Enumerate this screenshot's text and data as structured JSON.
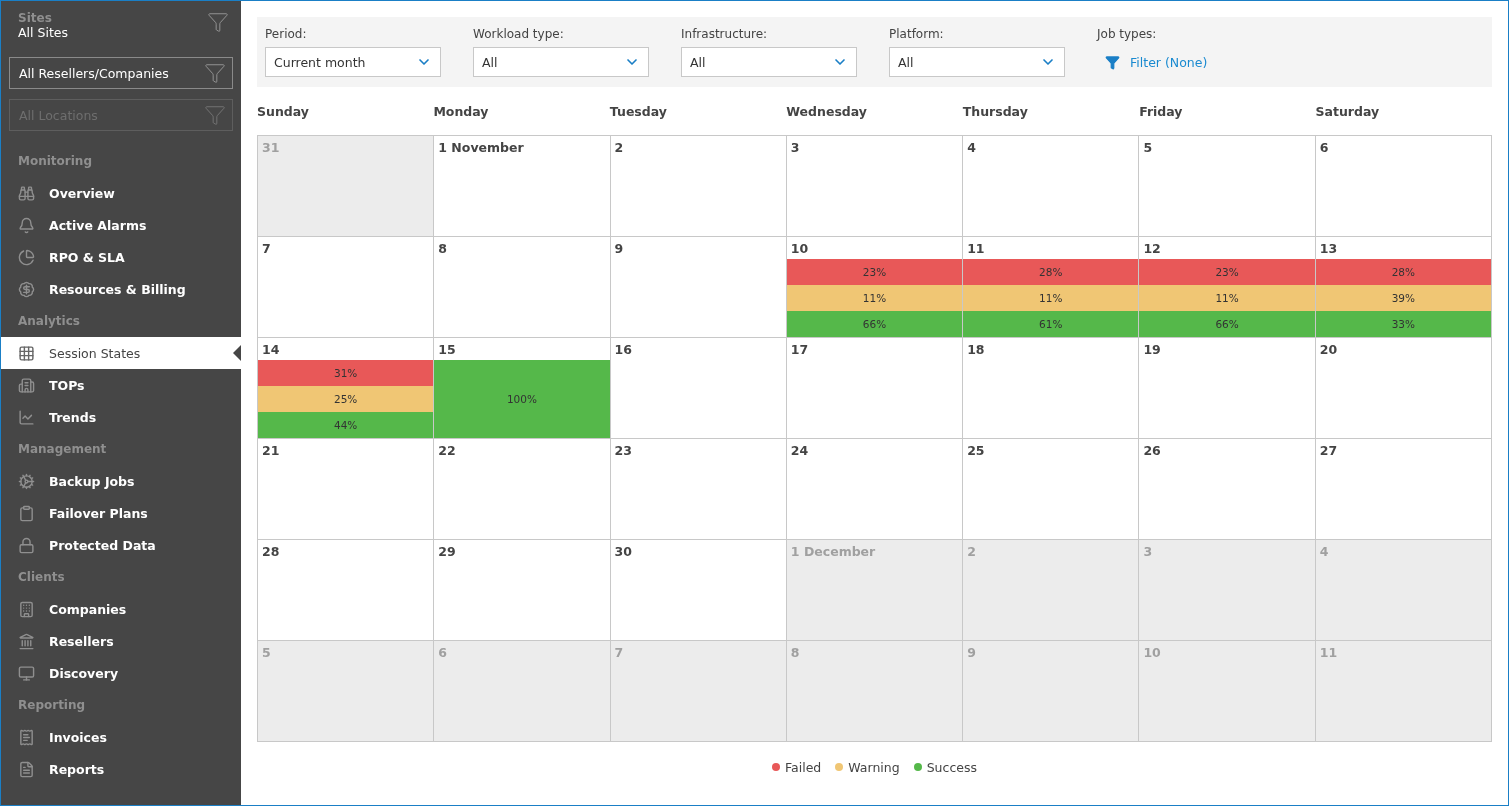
{
  "sidebar": {
    "site_filter": {
      "label": "Sites",
      "value": "All Sites"
    },
    "filters": [
      {
        "value": "All Resellers/Companies",
        "disabled": false
      },
      {
        "value": "All Locations",
        "disabled": true
      }
    ],
    "sections": [
      {
        "heading": "Monitoring",
        "items": [
          {
            "label": "Overview",
            "selected": false
          },
          {
            "label": "Active Alarms",
            "selected": false
          },
          {
            "label": "RPO & SLA",
            "selected": false
          },
          {
            "label": "Resources & Billing",
            "selected": false
          }
        ]
      },
      {
        "heading": "Analytics",
        "items": [
          {
            "label": "Session States",
            "selected": true
          },
          {
            "label": "TOPs",
            "selected": false
          },
          {
            "label": "Trends",
            "selected": false
          }
        ]
      },
      {
        "heading": "Management",
        "items": [
          {
            "label": "Backup Jobs",
            "selected": false
          },
          {
            "label": "Failover Plans",
            "selected": false
          },
          {
            "label": "Protected Data",
            "selected": false
          }
        ]
      },
      {
        "heading": "Clients",
        "items": [
          {
            "label": "Companies",
            "selected": false
          },
          {
            "label": "Resellers",
            "selected": false
          },
          {
            "label": "Discovery",
            "selected": false
          }
        ]
      },
      {
        "heading": "Reporting",
        "items": [
          {
            "label": "Invoices",
            "selected": false
          },
          {
            "label": "Reports",
            "selected": false
          }
        ]
      }
    ]
  },
  "filters": [
    {
      "label": "Period:",
      "value": "Current month"
    },
    {
      "label": "Workload type:",
      "value": "All"
    },
    {
      "label": "Infrastructure:",
      "value": "All"
    },
    {
      "label": "Platform:",
      "value": "All"
    }
  ],
  "job_types": {
    "label": "Job types:",
    "link": "Filter (None)"
  },
  "weekdays": [
    "Sunday",
    "Monday",
    "Tuesday",
    "Wednesday",
    "Thursday",
    "Friday",
    "Saturday"
  ],
  "days": [
    {
      "label": "31",
      "muted": true
    },
    {
      "label": "1 November",
      "muted": false
    },
    {
      "label": "2",
      "muted": false
    },
    {
      "label": "3",
      "muted": false
    },
    {
      "label": "4",
      "muted": false
    },
    {
      "label": "5",
      "muted": false
    },
    {
      "label": "6",
      "muted": false
    },
    {
      "label": "7",
      "muted": false
    },
    {
      "label": "8",
      "muted": false
    },
    {
      "label": "9",
      "muted": false
    },
    {
      "label": "10",
      "muted": false,
      "bars": [
        {
          "kind": "failed",
          "text": "23%"
        },
        {
          "kind": "warning",
          "text": "11%"
        },
        {
          "kind": "success",
          "text": "66%"
        }
      ]
    },
    {
      "label": "11",
      "muted": false,
      "bars": [
        {
          "kind": "failed",
          "text": "28%"
        },
        {
          "kind": "warning",
          "text": "11%"
        },
        {
          "kind": "success",
          "text": "61%"
        }
      ]
    },
    {
      "label": "12",
      "muted": false,
      "bars": [
        {
          "kind": "failed",
          "text": "23%"
        },
        {
          "kind": "warning",
          "text": "11%"
        },
        {
          "kind": "success",
          "text": "66%"
        }
      ]
    },
    {
      "label": "13",
      "muted": false,
      "bars": [
        {
          "kind": "failed",
          "text": "28%"
        },
        {
          "kind": "warning",
          "text": "39%"
        },
        {
          "kind": "success",
          "text": "33%"
        }
      ]
    },
    {
      "label": "14",
      "muted": false,
      "bars": [
        {
          "kind": "failed",
          "text": "31%"
        },
        {
          "kind": "warning",
          "text": "25%"
        },
        {
          "kind": "success",
          "text": "44%"
        }
      ]
    },
    {
      "label": "15",
      "muted": false,
      "bars": [
        {
          "kind": "success",
          "text": "100%"
        }
      ]
    },
    {
      "label": "16",
      "muted": false
    },
    {
      "label": "17",
      "muted": false
    },
    {
      "label": "18",
      "muted": false
    },
    {
      "label": "19",
      "muted": false
    },
    {
      "label": "20",
      "muted": false
    },
    {
      "label": "21",
      "muted": false
    },
    {
      "label": "22",
      "muted": false
    },
    {
      "label": "23",
      "muted": false
    },
    {
      "label": "24",
      "muted": false
    },
    {
      "label": "25",
      "muted": false
    },
    {
      "label": "26",
      "muted": false
    },
    {
      "label": "27",
      "muted": false
    },
    {
      "label": "28",
      "muted": false
    },
    {
      "label": "29",
      "muted": false
    },
    {
      "label": "30",
      "muted": false
    },
    {
      "label": "1 December",
      "muted": true
    },
    {
      "label": "2",
      "muted": true
    },
    {
      "label": "3",
      "muted": true
    },
    {
      "label": "4",
      "muted": true
    },
    {
      "label": "5",
      "muted": true
    },
    {
      "label": "6",
      "muted": true
    },
    {
      "label": "7",
      "muted": true
    },
    {
      "label": "8",
      "muted": true
    },
    {
      "label": "9",
      "muted": true
    },
    {
      "label": "10",
      "muted": true
    },
    {
      "label": "11",
      "muted": true
    }
  ],
  "legend": [
    {
      "kind": "failed",
      "label": "Failed",
      "color": "#e85858"
    },
    {
      "kind": "warning",
      "label": "Warning",
      "color": "#f0c674"
    },
    {
      "kind": "success",
      "label": "Success",
      "color": "#55b84a"
    }
  ]
}
